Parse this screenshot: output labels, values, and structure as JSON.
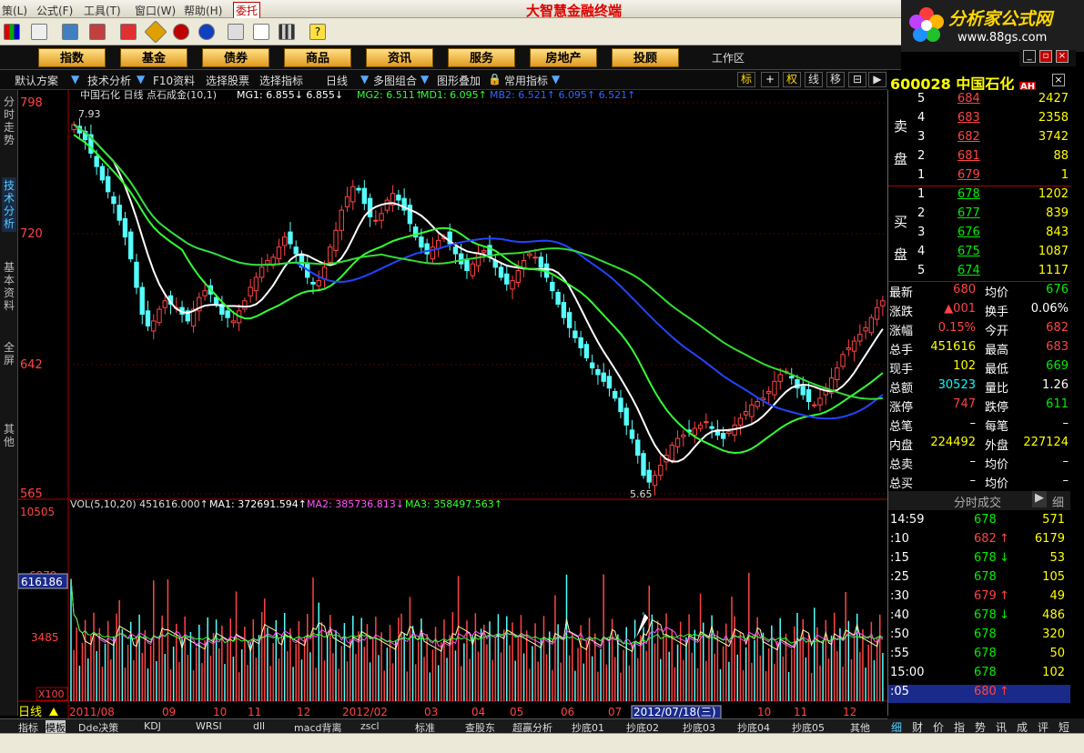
{
  "menu": {
    "items": [
      "策(L)",
      "公式(F)",
      "工具(T)",
      "窗口(W)",
      "帮助(H)"
    ],
    "wt": "委托",
    "title": "大智慧金融终端"
  },
  "logo": {
    "name": "分析家公式网",
    "url": "www.88gs.com"
  },
  "nav": {
    "buttons": [
      "指数",
      "基金",
      "债券",
      "商品",
      "资讯",
      "服务",
      "房地产",
      "投顾"
    ],
    "workzone": "工作区"
  },
  "sub": {
    "items": [
      "默认方案",
      "技术分析",
      "F10资料",
      "选择股票",
      "选择指标",
      "日线",
      "多图组合",
      "图形叠加",
      "常用指标"
    ],
    "right": [
      "标",
      "权",
      "线",
      "移"
    ]
  },
  "vtabs": [
    "分时走势",
    "技术分析",
    "基本资料",
    "全屏",
    "其他"
  ],
  "main": {
    "header": "中国石化 日线 点石成金(10,1)",
    "mg1": "MG1: 6.855↓ 6.855↓",
    "mg2": "MG2: 6.511↑",
    "md1": "MD1: 6.095↑",
    "mb2": "MB2: 6.521↑ 6.095↑ 6.521↑",
    "hi_label": "7.93",
    "lo_label": "5.65",
    "y_ticks": [
      "798",
      "720",
      "642",
      "565"
    ]
  },
  "vol": {
    "header": "VOL(5,10,20) 451616.000↑",
    "ma1": "MA1: 372691.594↑",
    "ma2": "MA2: 385736.813↓",
    "ma3": "MA3: 358497.563↑",
    "y_ticks": [
      "10505",
      "6979",
      "3485"
    ],
    "cursor": "616186",
    "unit": "X100"
  },
  "xaxis": {
    "labels": [
      "2011/08",
      "09",
      "10",
      "11",
      "12",
      "2012/02",
      "03",
      "04",
      "05",
      "06",
      "07",
      "2012/07/18(三)",
      "10",
      "11",
      "12"
    ],
    "period": "日线"
  },
  "stock": {
    "code": "600028",
    "name": "中国石化"
  },
  "sell": [
    {
      "lvl": "5",
      "p": "684",
      "v": "2427"
    },
    {
      "lvl": "4",
      "p": "683",
      "v": "2358"
    },
    {
      "lvl": "3",
      "p": "682",
      "v": "3742"
    },
    {
      "lvl": "2",
      "p": "681",
      "v": "88"
    },
    {
      "lvl": "1",
      "p": "679",
      "v": "1"
    }
  ],
  "buy": [
    {
      "lvl": "1",
      "p": "678",
      "v": "1202"
    },
    {
      "lvl": "2",
      "p": "677",
      "v": "839"
    },
    {
      "lvl": "3",
      "p": "676",
      "v": "843"
    },
    {
      "lvl": "4",
      "p": "675",
      "v": "1087"
    },
    {
      "lvl": "5",
      "p": "674",
      "v": "1117"
    }
  ],
  "sell_label": [
    "卖",
    "盘"
  ],
  "buy_label": [
    "买",
    "盘"
  ],
  "stats": [
    {
      "l": "最新",
      "v": "680",
      "l2": "均价",
      "v2": "676"
    },
    {
      "l": "涨跌",
      "v": "▲001",
      "l2": "换手",
      "v2": "0.06%"
    },
    {
      "l": "涨幅",
      "v": "0.15%",
      "l2": "今开",
      "v2": "682"
    },
    {
      "l": "总手",
      "v": "451616",
      "l2": "最高",
      "v2": "683"
    },
    {
      "l": "现手",
      "v": "102",
      "l2": "最低",
      "v2": "669"
    },
    {
      "l": "总额",
      "v": "30523",
      "l2": "量比",
      "v2": "1.26"
    },
    {
      "l": "涨停",
      "v": "747",
      "l2": "跌停",
      "v2": "611"
    },
    {
      "l": "总笔",
      "v": "–",
      "l2": "每笔",
      "v2": "–"
    },
    {
      "l": "内盘",
      "v": "224492",
      "l2": "外盘",
      "v2": "227124"
    },
    {
      "l": "总卖",
      "v": "–",
      "l2": "均价",
      "v2": "–"
    },
    {
      "l": "总买",
      "v": "–",
      "l2": "均价",
      "v2": "–"
    }
  ],
  "ticks_header": "分时成交",
  "ticks": [
    {
      "t": "14:59",
      "p": "678",
      "a": "",
      "v": "571"
    },
    {
      "t": ":10",
      "p": "682",
      "a": "↑",
      "v": "6179"
    },
    {
      "t": ":15",
      "p": "678",
      "a": "↓",
      "v": "53"
    },
    {
      "t": ":25",
      "p": "678",
      "a": "",
      "v": "105"
    },
    {
      "t": ":30",
      "p": "679",
      "a": "↑",
      "v": "49"
    },
    {
      "t": ":40",
      "p": "678",
      "a": "↓",
      "v": "486"
    },
    {
      "t": ":50",
      "p": "678",
      "a": "",
      "v": "320"
    },
    {
      "t": ":55",
      "p": "678",
      "a": "",
      "v": "50"
    },
    {
      "t": "15:00",
      "p": "678",
      "a": "",
      "v": "102"
    },
    {
      "t": ":05",
      "p": "680",
      "a": "↑",
      "v": ""
    }
  ],
  "bottom": {
    "tabs": [
      "指标",
      "模板",
      "Dde决策",
      "KDJ",
      "WRSI",
      "dll",
      "macd背离",
      "zscl",
      "标准",
      "查股东",
      "超赢分析",
      "抄底01",
      "抄底02",
      "抄底03",
      "抄底04",
      "抄底05",
      "其他"
    ],
    "right": [
      "细",
      "财",
      "价",
      "指",
      "势",
      "讯",
      "成",
      "评",
      "短"
    ]
  },
  "chart_data": {
    "type": "candlestick",
    "title": "中国石化 日线",
    "period_range": [
      "2011/08",
      "2012/12"
    ],
    "price_axis": {
      "ticks": [
        798,
        720,
        642,
        565
      ]
    },
    "annotations": {
      "high": 7.93,
      "low": 5.65
    },
    "indicators": {
      "MG1": 6.855,
      "MG2": 6.511,
      "MD1": 6.095,
      "MB2": 6.521
    },
    "volume": {
      "last": 451616.0,
      "MA1": 372691.594,
      "MA2": 385736.813,
      "MA3": 358497.563,
      "axis_ticks": [
        10505,
        6979,
        3485
      ]
    },
    "closes": [
      785,
      780,
      776,
      768,
      760,
      752,
      745,
      738,
      728,
      718,
      705,
      688,
      672,
      665,
      668,
      675,
      680,
      678,
      676,
      672,
      668,
      675,
      682,
      686,
      684,
      678,
      672,
      670,
      668,
      674,
      680,
      688,
      694,
      700,
      704,
      706,
      712,
      718,
      714,
      708,
      700,
      694,
      690,
      692,
      700,
      712,
      722,
      734,
      742,
      748,
      746,
      738,
      730,
      728,
      732,
      740,
      744,
      740,
      734,
      726,
      718,
      712,
      708,
      712,
      716,
      718,
      714,
      708,
      702,
      698,
      702,
      708,
      710,
      706,
      700,
      694,
      690,
      692,
      698,
      704,
      708,
      706,
      700,
      694,
      686,
      678,
      670,
      664,
      658,
      652,
      646,
      640,
      636,
      632,
      628,
      622,
      614,
      606,
      598,
      588,
      576,
      572,
      576,
      582,
      588,
      594,
      598,
      600,
      602,
      604,
      606,
      608,
      604,
      600,
      598,
      602,
      606,
      610,
      614,
      618,
      620,
      622,
      626,
      632,
      636,
      638,
      634,
      628,
      624,
      620,
      618,
      622,
      628,
      634,
      640,
      648,
      652,
      656,
      660,
      664,
      670,
      676,
      680
    ]
  }
}
